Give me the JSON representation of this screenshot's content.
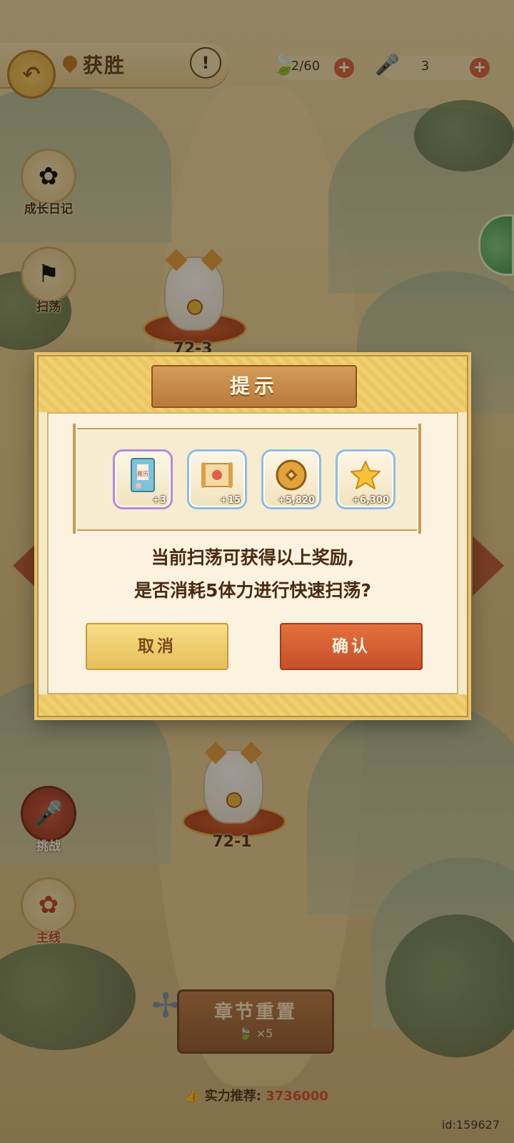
{
  "header": {
    "title": "获胜",
    "warning_symbol": "!",
    "resources": [
      {
        "name": "stamina",
        "icon": "leaf-icon",
        "value": "2/60"
      },
      {
        "name": "microphone",
        "icon": "microphone-icon",
        "value": "3"
      }
    ]
  },
  "sidebar": {
    "items": [
      {
        "label": "成长日记",
        "icon": "flower-icon"
      },
      {
        "label": "扫荡",
        "icon": "flag-icon"
      },
      {
        "label": "挑战",
        "icon": "microphone-icon"
      },
      {
        "label": "主线",
        "icon": "flower-icon"
      }
    ]
  },
  "stages": [
    {
      "label": "72-3"
    },
    {
      "label": "72-1"
    }
  ],
  "dialog": {
    "title": "提示",
    "rewards": [
      {
        "name": "calendar-item",
        "icon": "book-icon",
        "caption": "雁历",
        "count": "+3"
      },
      {
        "name": "scroll-item",
        "icon": "scroll-icon",
        "count": "+15"
      },
      {
        "name": "coin-item",
        "icon": "coin-icon",
        "count": "+5,820"
      },
      {
        "name": "star-item",
        "icon": "star-icon",
        "count": "+6,300"
      }
    ],
    "message_line1": "当前扫荡可获得以上奖励,",
    "message_line2": "是否消耗5体力进行快速扫荡?",
    "cancel_label": "取消",
    "confirm_label": "确认"
  },
  "bottom": {
    "reset_label": "章节重置",
    "reset_cost": "×5",
    "power_label": "实力推荐:",
    "power_value": "3736000",
    "user_id": "id:159627"
  },
  "colors": {
    "accent_orange": "#c8502a",
    "gold": "#e6bf5a",
    "dialog_bg": "#fbf3df",
    "text_brown": "#4a2a12"
  }
}
